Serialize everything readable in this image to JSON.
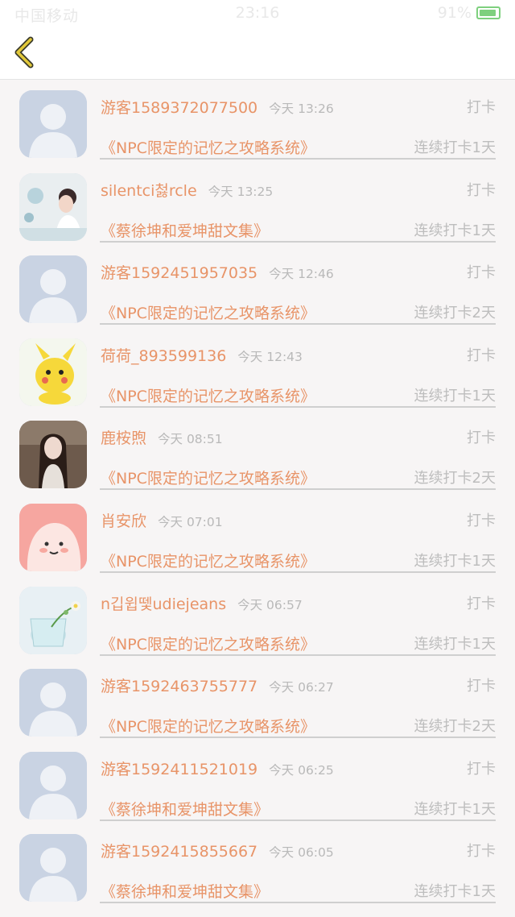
{
  "status_bar": {
    "carrier": "中国移动",
    "time": "23:16",
    "battery": "91%",
    "battery_level": 0.91
  },
  "colors": {
    "accent": "#e89468",
    "muted": "#bdbdbd",
    "back_icon": "#e2c93a",
    "placeholder_avatar": "#c9d3e3"
  },
  "nav": {
    "back_icon": "chevron-left-icon"
  },
  "checkins": [
    {
      "user": "游客1589372077500",
      "time": "今天 13:26",
      "action": "打卡",
      "book": "《NPC限定的记忆之攻略系统》",
      "streak": "连续打卡1天",
      "avatar": "placeholder"
    },
    {
      "user": "silentci첧rcle",
      "time": "今天 13:25",
      "action": "打卡",
      "book": "《蔡徐坤和爱坤甜文集》",
      "streak": "连续打卡1天",
      "avatar": "photo-girl"
    },
    {
      "user": "游客1592451957035",
      "time": "今天 12:46",
      "action": "打卡",
      "book": "《NPC限定的记忆之攻略系统》",
      "streak": "连续打卡2天",
      "avatar": "placeholder"
    },
    {
      "user": "荷荷_893599136",
      "time": "今天 12:43",
      "action": "打卡",
      "book": "《NPC限定的记忆之攻略系统》",
      "streak": "连续打卡1天",
      "avatar": "pikachu"
    },
    {
      "user": "鹿桉煦",
      "time": "今天 08:51",
      "action": "打卡",
      "book": "《NPC限定的记忆之攻略系统》",
      "streak": "连续打卡2天",
      "avatar": "photo-woman"
    },
    {
      "user": "肖安欣",
      "time": "今天 07:01",
      "action": "打卡",
      "book": "《NPC限定的记忆之攻略系统》",
      "streak": "连续打卡1天",
      "avatar": "pink-cartoon"
    },
    {
      "user": "n깁윕뗓udiejeans",
      "time": "今天 06:57",
      "action": "打卡",
      "book": "《NPC限定的记忆之攻略系统》",
      "streak": "连续打卡1天",
      "avatar": "flower-glass"
    },
    {
      "user": "游客1592463755777",
      "time": "今天 06:27",
      "action": "打卡",
      "book": "《NPC限定的记忆之攻略系统》",
      "streak": "连续打卡2天",
      "avatar": "placeholder"
    },
    {
      "user": "游客1592411521019",
      "time": "今天 06:25",
      "action": "打卡",
      "book": "《蔡徐坤和爱坤甜文集》",
      "streak": "连续打卡1天",
      "avatar": "placeholder"
    },
    {
      "user": "游客1592415855667",
      "time": "今天 06:05",
      "action": "打卡",
      "book": "《蔡徐坤和爱坤甜文集》",
      "streak": "连续打卡1天",
      "avatar": "placeholder"
    }
  ]
}
